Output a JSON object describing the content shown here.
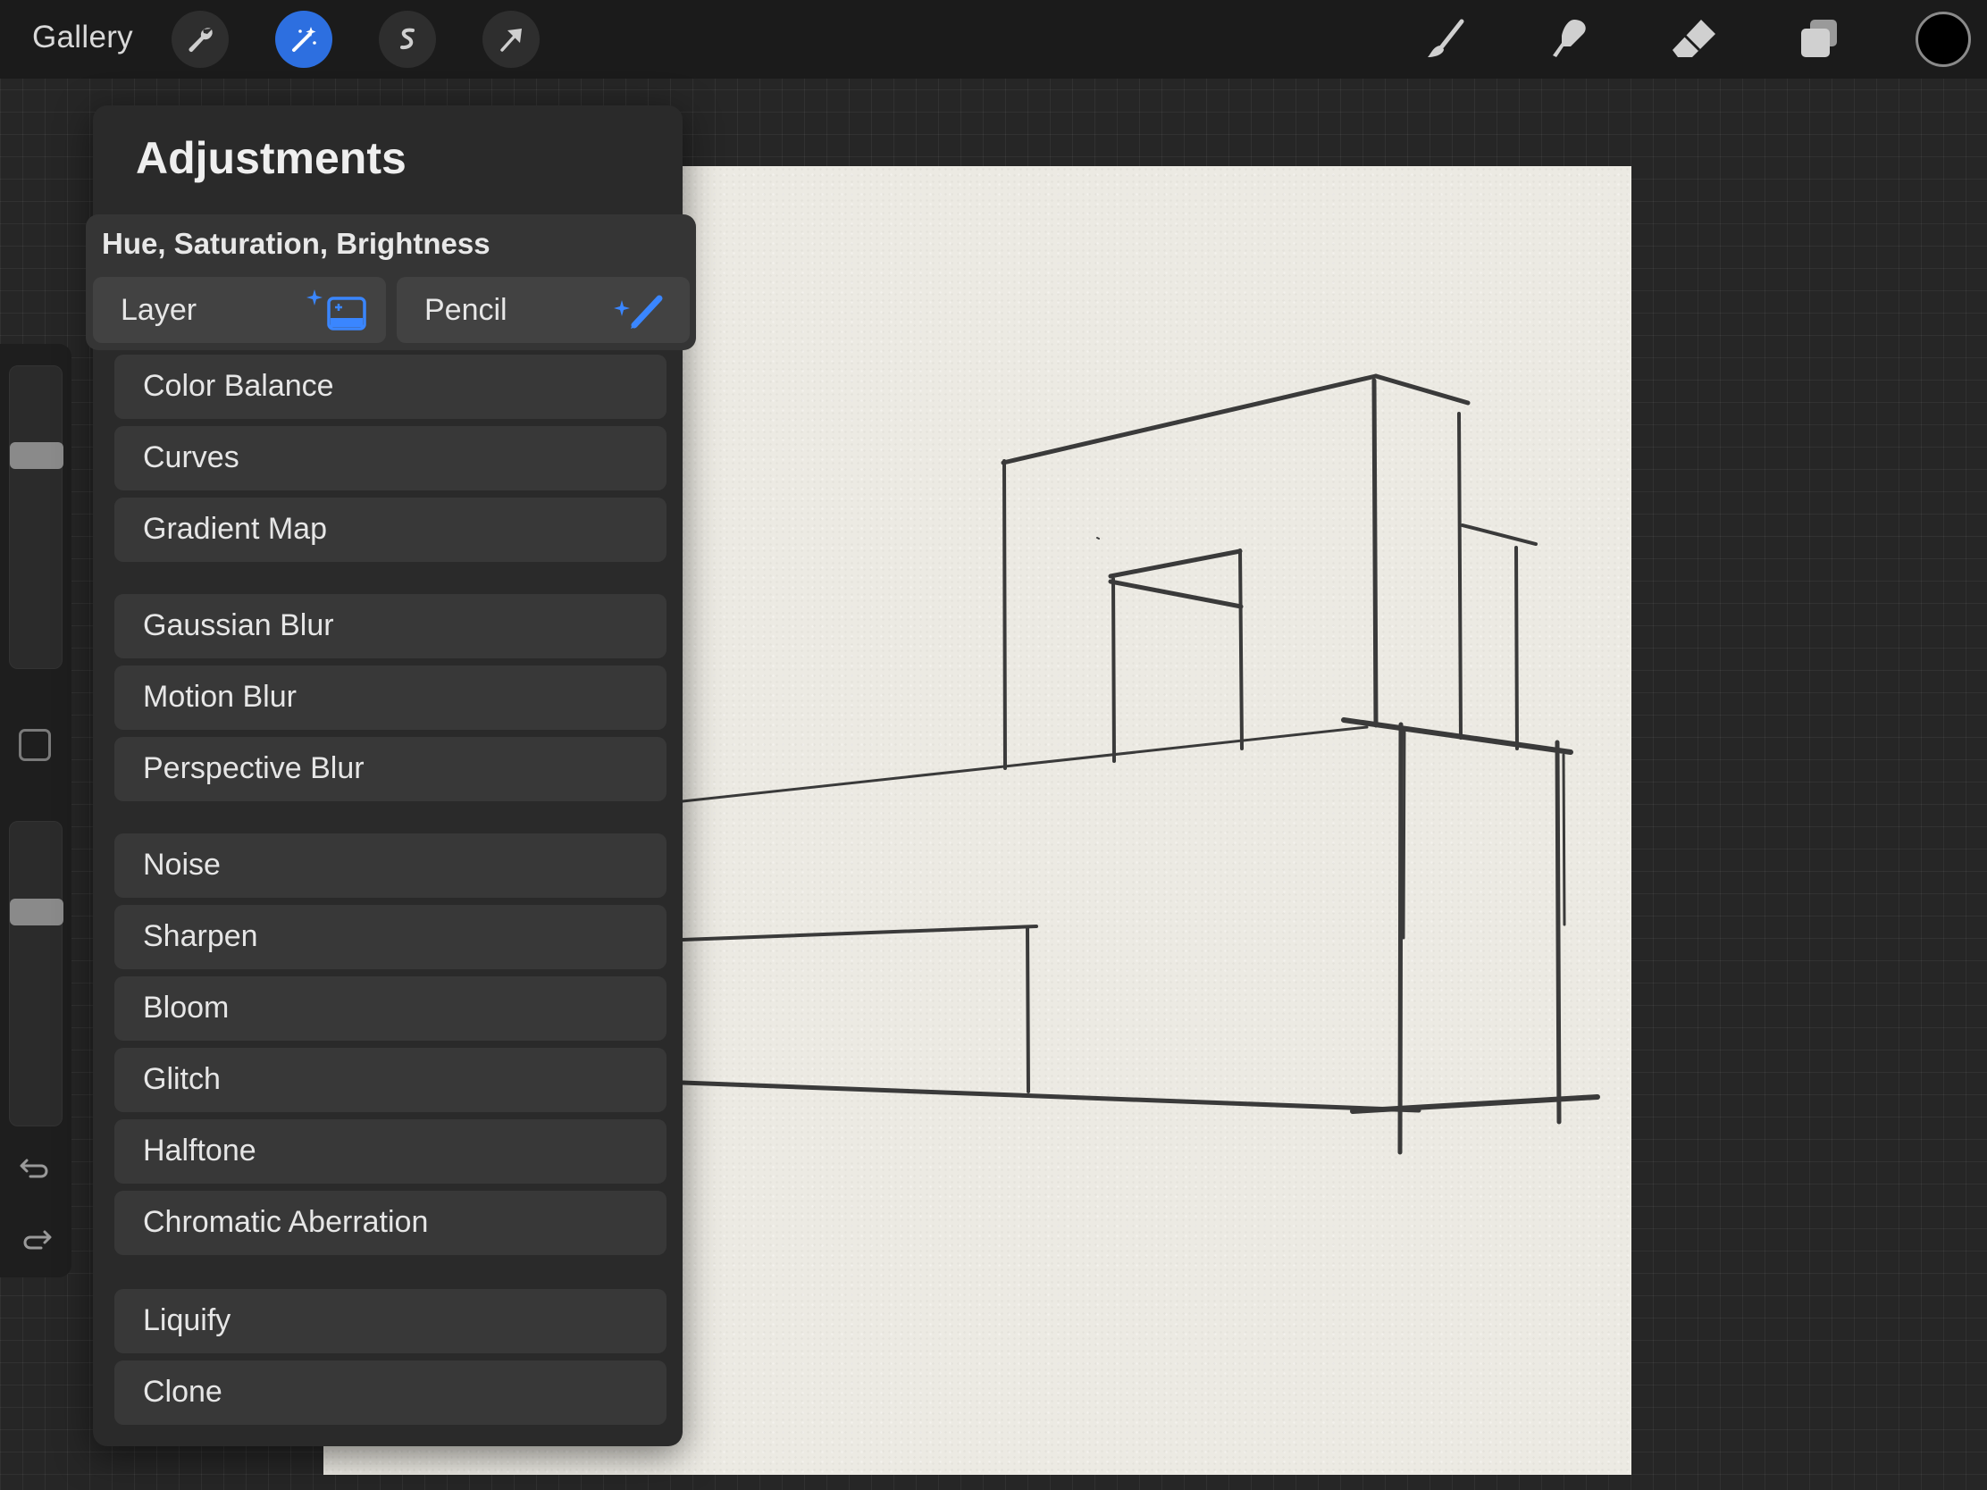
{
  "topbar": {
    "gallery_label": "Gallery",
    "left_tools": [
      "wrench-icon",
      "magic-wand-icon",
      "selection-icon",
      "transform-icon"
    ],
    "active_tool": "magic-wand-icon",
    "right_tools": [
      "brush-icon",
      "smudge-icon",
      "eraser-icon",
      "layers-icon"
    ],
    "current_color": "#000000"
  },
  "panel": {
    "title": "Adjustments",
    "section_title": "Hue, Saturation, Brightness",
    "targets": [
      {
        "label": "Layer",
        "icon": "layer-sparkle-icon"
      },
      {
        "label": "Pencil",
        "icon": "pencil-sparkle-icon"
      }
    ],
    "groups": [
      [
        "Color Balance",
        "Curves",
        "Gradient Map"
      ],
      [
        "Gaussian Blur",
        "Motion Blur",
        "Perspective Blur"
      ],
      [
        "Noise",
        "Sharpen",
        "Bloom",
        "Glitch",
        "Halftone",
        "Chromatic Aberration"
      ],
      [
        "Liquify",
        "Clone"
      ]
    ],
    "items": {
      "color_balance": "Color Balance",
      "curves": "Curves",
      "gradient_map": "Gradient Map",
      "gaussian_blur": "Gaussian Blur",
      "motion_blur": "Motion Blur",
      "perspective_blur": "Perspective Blur",
      "noise": "Noise",
      "sharpen": "Sharpen",
      "bloom": "Bloom",
      "glitch": "Glitch",
      "halftone": "Halftone",
      "chromatic_aberration": "Chromatic Aberration",
      "liquify": "Liquify",
      "clone": "Clone"
    }
  },
  "sidebar": {
    "brush_size_level": 0.3,
    "opacity_level": 0.3,
    "icons": [
      "modify-button-icon",
      "undo-icon",
      "redo-icon"
    ]
  },
  "colors": {
    "accent": "#2d6fe0",
    "panel_bg": "#2a2a2a",
    "paper": "#eceae3"
  }
}
